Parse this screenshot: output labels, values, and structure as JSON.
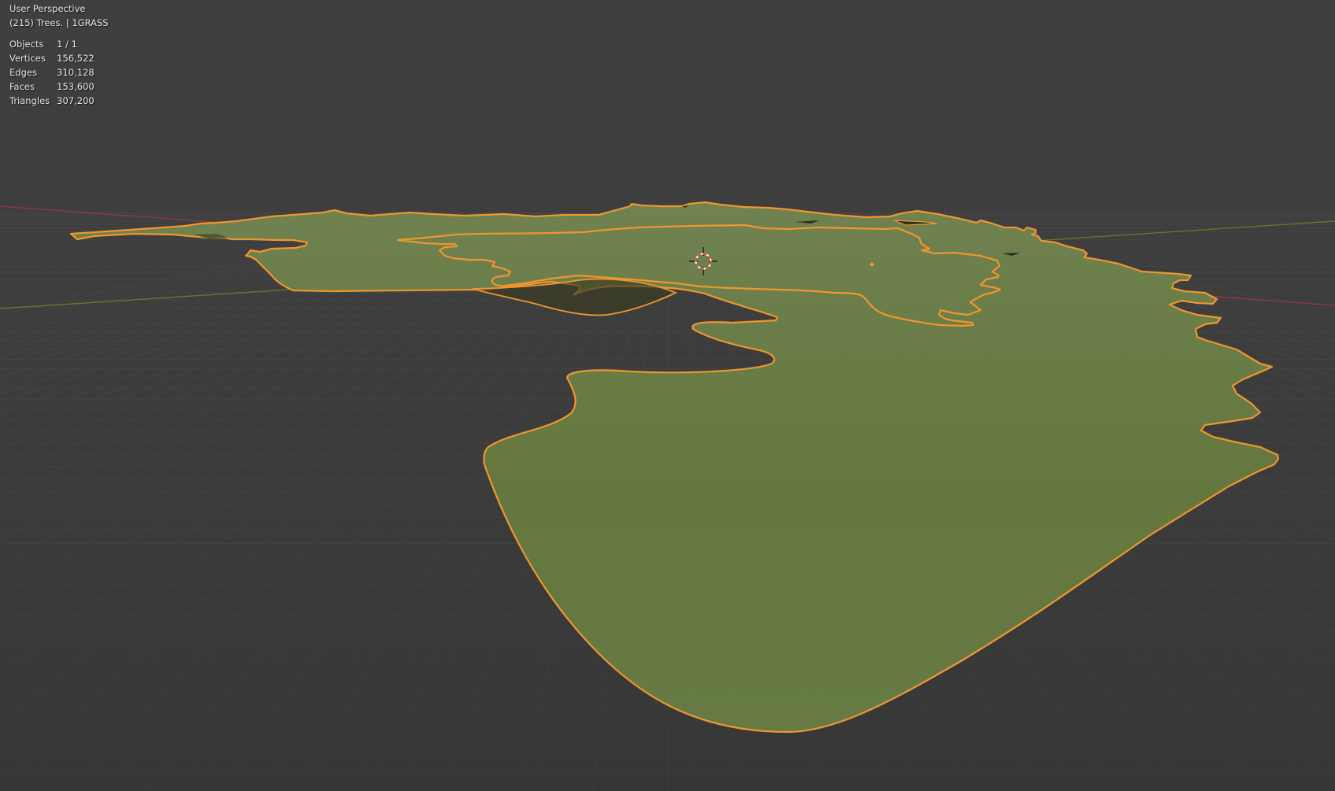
{
  "viewport": {
    "view_name": "User Perspective",
    "object_info": "(215) Trees. | 1GRASS"
  },
  "statistics": [
    {
      "label": "Objects",
      "value": "1 / 1"
    },
    {
      "label": "Vertices",
      "value": "156,522"
    },
    {
      "label": "Edges",
      "value": "310,128"
    },
    {
      "label": "Faces",
      "value": "153,600"
    },
    {
      "label": "Triangles",
      "value": "307,200"
    }
  ],
  "colors": {
    "background": "#3d3d3d",
    "grid_line": "#464646",
    "x_axis": "#8a3a42",
    "y_axis": "#5a7a2e",
    "mesh_fill": "#667a44",
    "selection_outline": "#f0962e",
    "cursor_red": "#e63c3c"
  },
  "icons": {
    "cursor": "3d-cursor-icon",
    "origin": "object-origin-icon"
  }
}
